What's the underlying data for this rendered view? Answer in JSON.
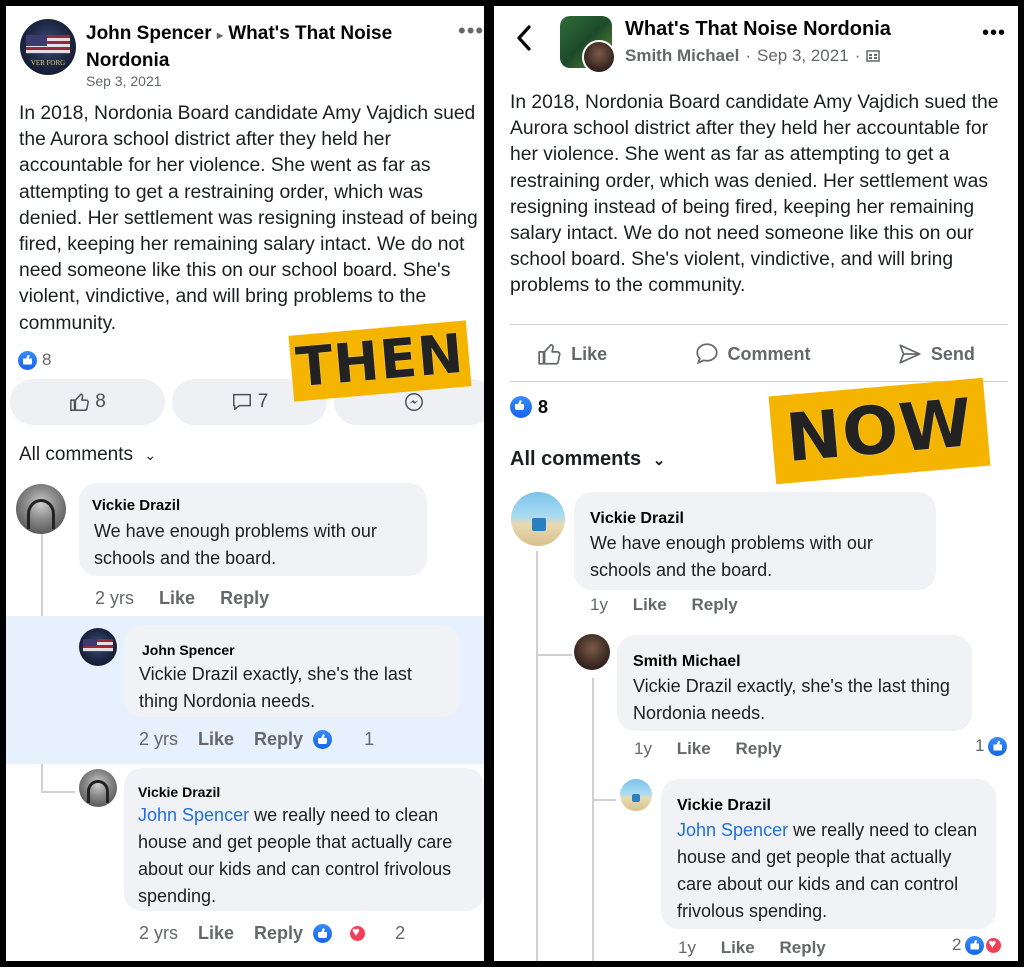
{
  "then": {
    "stamp": "THEN",
    "header": {
      "author": "John Spencer",
      "arrow": "▸",
      "group": "What's That Noise Nordonia",
      "date": "Sep 3, 2021",
      "avatar_text": "VER FORG"
    },
    "post_text": "In 2018, Nordonia Board candidate Amy Vajdich sued the Aurora school district after they held her accountable for her violence. She went as far as attempting to get a restraining order, which was denied. Her settlement was resigning instead of being fired, keeping her remaining salary intact. We do not need someone like this on our school board. She's violent, vindictive, and will bring problems to the community.",
    "reaction_count": "8",
    "buttons": {
      "like_count": "8",
      "comment_count": "7"
    },
    "all_comments": "All comments",
    "comments": [
      {
        "name": "Vickie Drazil",
        "text": "We have enough problems with our schools and the board.",
        "time": "2 yrs",
        "like": "Like",
        "reply": "Reply"
      },
      {
        "name": "John Spencer",
        "text": "Vickie Drazil exactly, she's the last thing Nordonia needs.",
        "time": "2 yrs",
        "like": "Like",
        "reply": "Reply",
        "reactions": "1"
      },
      {
        "name": "Vickie Drazil",
        "mention": "John Spencer",
        "text": " we really need to clean house and get people that actually care about our kids and can control frivolous spending.",
        "time": "2 yrs",
        "like": "Like",
        "reply": "Reply",
        "reactions": "2"
      }
    ]
  },
  "now": {
    "stamp": "NOW",
    "header": {
      "group": "What's That Noise Nordonia",
      "author": "Smith Michael",
      "date": "Sep 3, 2021",
      "sep": "·"
    },
    "post_text": "In 2018, Nordonia Board candidate Amy Vajdich sued the Aurora school district after they held her accountable for her violence. She went as far as attempting to get a restraining order, which was denied. Her settlement was resigning instead of being fired, keeping her remaining salary intact. We do not need someone like this on our school board. She's violent, vindictive, and will bring problems to the community.",
    "actions": {
      "like": "Like",
      "comment": "Comment",
      "send": "Send"
    },
    "reaction_count": "8",
    "all_comments": "All comments",
    "comments": [
      {
        "name": "Vickie Drazil",
        "text": "We have enough problems with our schools and the board.",
        "time": "1y",
        "like": "Like",
        "reply": "Reply"
      },
      {
        "name": "Smith Michael",
        "text": "Vickie Drazil exactly, she's the last thing Nordonia needs.",
        "time": "1y",
        "like": "Like",
        "reply": "Reply",
        "reactions": "1"
      },
      {
        "name": "Vickie Drazil",
        "mention": "John Spencer",
        "text": " we really need to clean house and get people that actually care about our kids and can control frivolous spending.",
        "time": "1y",
        "like": "Like",
        "reply": "Reply",
        "reactions": "2"
      }
    ]
  },
  "colors": {
    "link": "#216fdb",
    "stamp": "#f4b400",
    "like_blue": "#1877f2",
    "heart": "#f33e58"
  }
}
